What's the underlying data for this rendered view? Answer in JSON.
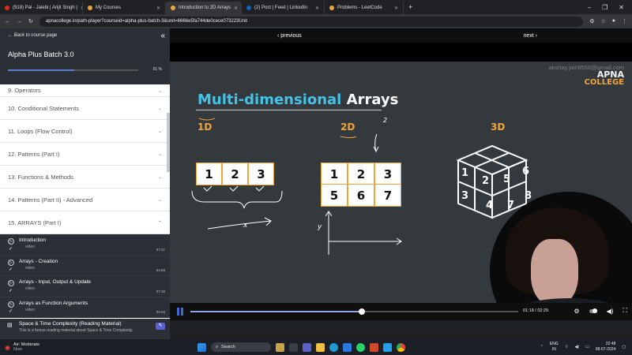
{
  "browser": {
    "tabs": [
      {
        "title": "(919) Pal - Jalebi | Arijit Singh |",
        "color": "#e02b20"
      },
      {
        "title": "My Courses",
        "color": "#f1a43a"
      },
      {
        "title": "Introduction to 2D Arrays",
        "color": "#f1a43a",
        "active": true
      },
      {
        "title": "(2) Post | Feed | LinkedIn",
        "color": "#0a66c2"
      },
      {
        "title": "Problems - LeetCode",
        "color": "#f1a43a"
      }
    ],
    "new_tab": "+",
    "url": "apnacollege.in/path-player?courseid=alpha-plus-batch-3&unit=6666e5fa744de0cece073223Unit"
  },
  "sidebar": {
    "back_label": "← Back to course page",
    "course_title": "Alpha Plus Batch 3.0",
    "progress_pct": "51 %",
    "progress_value": 0.51,
    "modules": [
      {
        "label": "9. Operators"
      },
      {
        "label": "10. Conditional Statements"
      },
      {
        "label": "11. Loops (Flow Control)"
      },
      {
        "label": "12. Patterns (Part I)"
      },
      {
        "label": "13. Functions & Methods"
      },
      {
        "label": "14. Patterns (Part II) - Advanced"
      },
      {
        "label": "15. ARRAYS (Part I)"
      }
    ],
    "lessons": [
      {
        "name": "Introduction",
        "type": "video",
        "time": "07:37"
      },
      {
        "name": "Arrays - Creation",
        "type": "video",
        "time": "04:59"
      },
      {
        "name": "Arrays - Input, Output & Update",
        "type": "video",
        "time": "07:18"
      },
      {
        "name": "Arrays as Function Arguments",
        "type": "video",
        "time": "03:28"
      }
    ],
    "reading": {
      "name": "Space & Time Complexity (Reading Material)",
      "desc": "This is a bonus reading material about Space & Time Complexity."
    }
  },
  "player": {
    "previous": "‹ previous",
    "next": "next ›",
    "time": "01:18 / 02:29",
    "progress_value": 0.524
  },
  "slide": {
    "watermark": "akshay.jain9568@gmail.com",
    "brand_line1": "APNA",
    "brand_line2": "COLLEGE",
    "title_part1": "Multi-dimensional",
    "title_part2": "Arrays",
    "label_1d": "1D",
    "label_2d": "2D",
    "label_3d": "3D",
    "array_1d": [
      "1",
      "2",
      "3"
    ],
    "array_2d": [
      [
        "1",
        "2",
        "3"
      ],
      [
        "5",
        "6",
        "7"
      ]
    ],
    "cube_numbers": [
      "1",
      "2",
      "5",
      "6",
      "3",
      "4",
      "7",
      "8"
    ],
    "ink_x": "x",
    "ink_y": "y",
    "ink_2": "2"
  },
  "taskbar": {
    "weather_title": "Air: Moderate",
    "weather_sub": "Now",
    "search": "Search",
    "lang": "ENG",
    "lang2": "IN",
    "time": "22:48",
    "date": "08-07-2024"
  }
}
